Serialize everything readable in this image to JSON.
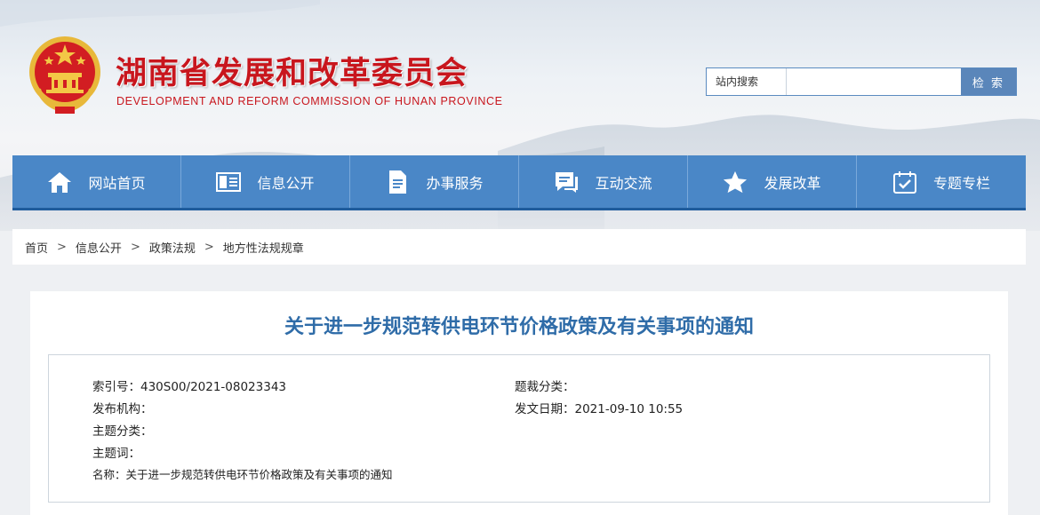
{
  "header": {
    "site_title": "湖南省发展和改革委员会",
    "site_subtitle": "DEVELOPMENT AND REFORM COMMISSION OF HUNAN PROVINCE",
    "emblem_icon": "national-emblem-icon"
  },
  "search": {
    "label": "站内搜索",
    "value": "",
    "placeholder": "",
    "button_label": "检 索"
  },
  "nav": {
    "items": [
      {
        "label": "网站首页",
        "icon": "home-icon"
      },
      {
        "label": "信息公开",
        "icon": "info-card-icon"
      },
      {
        "label": "办事服务",
        "icon": "document-icon"
      },
      {
        "label": "互动交流",
        "icon": "chat-icon"
      },
      {
        "label": "发展改革",
        "icon": "star-icon"
      },
      {
        "label": "专题专栏",
        "icon": "calendar-check-icon"
      }
    ],
    "background_color": "#4a87c7"
  },
  "breadcrumb": {
    "items": [
      "首页",
      "信息公开",
      "政策法规",
      "地方性法规规章"
    ],
    "separator": ">"
  },
  "article": {
    "title": "关于进一步规范转供电环节价格政策及有关事项的通知",
    "meta": {
      "index_no": "索引号：430S00/2021-08023343",
      "genre": "题裁分类：",
      "publisher": "发布机构：",
      "date": "发文日期：2021-09-10 10:55",
      "topic": "主题分类：",
      "keywords": "主题词：",
      "name": "名称：关于进一步规范转供电环节价格政策及有关事项的通知"
    }
  },
  "colors": {
    "brand_red": "#c8161d",
    "nav_blue": "#4a87c7",
    "title_blue": "#2f6ca8"
  }
}
